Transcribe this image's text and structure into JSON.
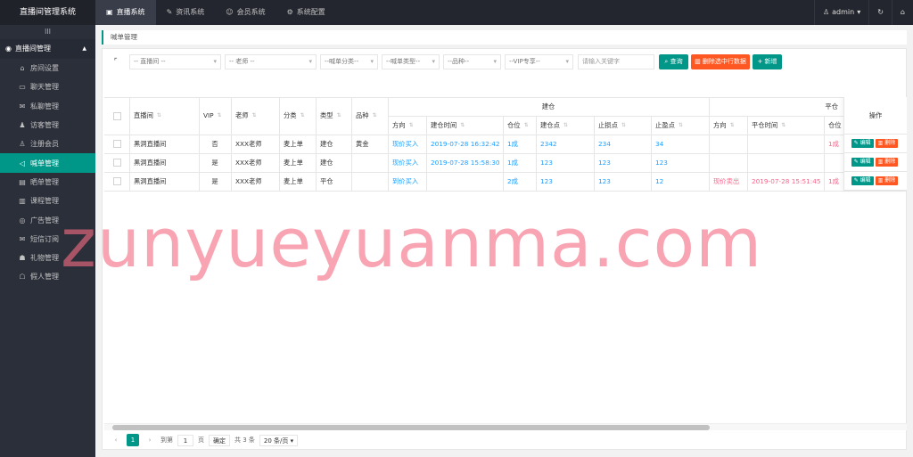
{
  "app": {
    "title": "直播间管理系统"
  },
  "topnav": [
    {
      "label": "直播系统",
      "icon": "folder-icon",
      "active": true
    },
    {
      "label": "资讯系统",
      "icon": "edit-icon",
      "active": false
    },
    {
      "label": "会员系统",
      "icon": "smile-icon",
      "active": false
    },
    {
      "label": "系统配置",
      "icon": "gear-icon",
      "active": false
    }
  ],
  "user": {
    "name": "admin"
  },
  "sidebar": {
    "toggle": "III",
    "group": "直播间管理",
    "items": [
      {
        "label": "房间设置",
        "icon": "home-icon"
      },
      {
        "label": "聊天管理",
        "icon": "chat-icon"
      },
      {
        "label": "私聊管理",
        "icon": "message-icon"
      },
      {
        "label": "访客管理",
        "icon": "visitor-icon"
      },
      {
        "label": "注册会员",
        "icon": "user-icon"
      },
      {
        "label": "喊单管理",
        "icon": "megaphone-icon",
        "active": true
      },
      {
        "label": "晒单管理",
        "icon": "list-icon"
      },
      {
        "label": "课程管理",
        "icon": "book-icon"
      },
      {
        "label": "广告管理",
        "icon": "ad-icon"
      },
      {
        "label": "短信订阅",
        "icon": "mail-icon"
      },
      {
        "label": "礼物管理",
        "icon": "gift-icon"
      },
      {
        "label": "假人管理",
        "icon": "robot-icon"
      }
    ]
  },
  "breadcrumb": "喊单管理",
  "filters": {
    "room": "-- 直播间 --",
    "teacher": "-- 老师 --",
    "category": "--喊单分类--",
    "type": "--喊单类型--",
    "variety": "--品种--",
    "vip": "--VIP专享--",
    "keyword_placeholder": "请输入关键字",
    "search_label": "查询",
    "delete_selected_label": "删除选中行数据",
    "add_label": "新增"
  },
  "table": {
    "headers": {
      "room": "直播间",
      "vip": "VIP",
      "teacher": "老师",
      "category": "分类",
      "type": "类型",
      "variety": "品种",
      "open_group": "建仓",
      "close_group": "平仓",
      "ops": "操作",
      "direction": "方向",
      "open_time": "建仓时间",
      "position": "仓位",
      "open_point": "建仓点",
      "stop_loss": "止损点",
      "take_profit": "止盈点",
      "close_direction": "方向",
      "close_time": "平仓时间",
      "close_position": "仓位"
    },
    "rows": [
      {
        "room": "黑洞直播间",
        "vip": "否",
        "teacher": "XXX老师",
        "category": "麦上单",
        "type": "建仓",
        "variety": "黄金",
        "direction": "现价买入",
        "open_time": "2019-07-28 16:32:42",
        "position": "1成",
        "open_point": "2342",
        "stop_loss": "234",
        "take_profit": "34",
        "close_direction": "",
        "close_time": "",
        "close_position": "1成"
      },
      {
        "room": "黑洞直播间",
        "vip": "是",
        "teacher": "XXX老师",
        "category": "麦上单",
        "type": "建仓",
        "variety": "",
        "direction": "现价买入",
        "open_time": "2019-07-28 15:58:30",
        "position": "1成",
        "open_point": "123",
        "stop_loss": "123",
        "take_profit": "123",
        "close_direction": "",
        "close_time": "",
        "close_position": ""
      },
      {
        "room": "黑洞直播间",
        "vip": "是",
        "teacher": "XXX老师",
        "category": "麦上单",
        "type": "平仓",
        "variety": "",
        "direction": "到价买入",
        "open_time": "",
        "position": "2成",
        "open_point": "123",
        "stop_loss": "123",
        "take_profit": "12",
        "close_direction": "现价卖出",
        "close_time": "2019-07-28 15:51:45",
        "close_position": "1成"
      }
    ],
    "edit_label": "编辑",
    "delete_label": "删除"
  },
  "pager": {
    "current": "1",
    "goto_label": "到第",
    "goto_value": "1",
    "page_label": "页",
    "confirm_label": "确定",
    "total": "共 3 条",
    "page_size": "20 条/页"
  },
  "watermark": "zunyueyuanma.com",
  "colors": {
    "accent": "#009688",
    "danger": "#ff5722",
    "link": "#1e9fff",
    "sell": "#f4698c"
  }
}
